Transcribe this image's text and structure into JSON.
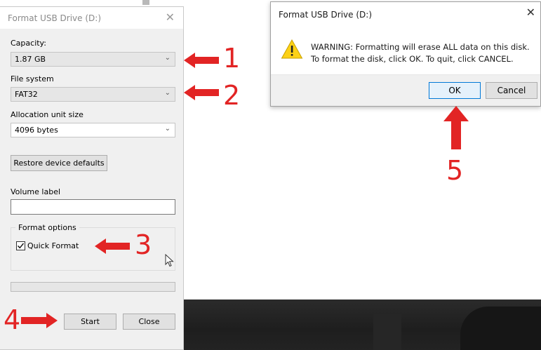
{
  "format_dialog": {
    "title": "Format USB Drive (D:)",
    "close_glyph": "✕",
    "capacity_label": "Capacity:",
    "capacity_value": "1.87 GB",
    "file_system_label": "File system",
    "file_system_value": "FAT32",
    "allocation_label": "Allocation unit size",
    "allocation_value": "4096 bytes",
    "restore_button": "Restore device defaults",
    "volume_label": "Volume label",
    "volume_value": "",
    "format_options_label": "Format options",
    "quick_format_label": "Quick Format",
    "quick_format_checked": true,
    "progress": 0,
    "start_button": "Start",
    "close_button": "Close"
  },
  "warning_dialog": {
    "title": "Format USB Drive (D:)",
    "close_glyph": "✕",
    "message_line1": "WARNING: Formatting will erase ALL data on this disk.",
    "message_line2": "To format the disk, click OK. To quit, click CANCEL.",
    "ok_button": "OK",
    "cancel_button": "Cancel"
  },
  "annotations": {
    "step1": "1",
    "step2": "2",
    "step3": "3",
    "step4": "4",
    "step5": "5",
    "color": "#e22424"
  },
  "icons": {
    "warning": "warning-icon",
    "chevron": "chevron-down-icon",
    "cursor": "mouse-cursor-icon"
  }
}
